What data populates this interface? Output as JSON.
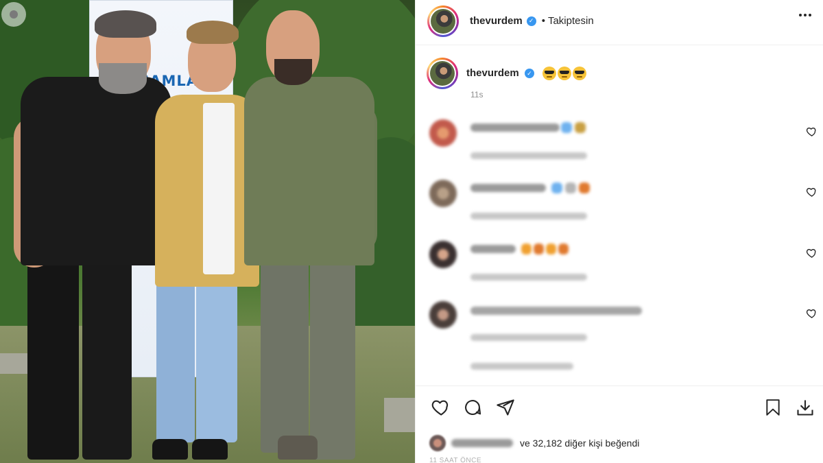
{
  "post": {
    "username": "thevurdem",
    "verified_mark": "✓",
    "follow_status": "Takiptesin",
    "separator": "•",
    "caption_emojis": [
      "sunglasses-emoji",
      "sunglasses-emoji",
      "sunglasses-emoji"
    ],
    "posted": "11s"
  },
  "photo": {
    "banner_text": "ĞAMLAR M"
  },
  "comments": [
    {
      "avatar_color": "#c25a4c",
      "name_color": "#9b9b9b",
      "badge_colors": [
        "#6fb2ef",
        "#c9a043"
      ]
    },
    {
      "avatar_color": "#7e6a5a",
      "name_color": "#9b9b9b",
      "badge_colors": [
        "#6fb2ef",
        "#e07a2f"
      ]
    },
    {
      "avatar_color": "#3a3030",
      "name_color": "#9b9b9b",
      "badge_colors": [
        "#f0a030",
        "#e07a2f",
        "#f0a030",
        "#e07a2f"
      ]
    },
    {
      "avatar_color": "#4a3e3a",
      "name_color": "#9b9b9b",
      "badge_colors": []
    }
  ],
  "likes": {
    "text": "ve 32,182 diğer kişi beğendi"
  },
  "time_ago": "11 SAAT ÖNCE",
  "colors": {
    "verified_blue": "#3897f0",
    "text_primary": "#262626",
    "text_muted": "#8e8e8e"
  },
  "icons": [
    "heart-icon",
    "comment-icon",
    "share-icon",
    "bookmark-icon",
    "download-icon",
    "more-icon"
  ]
}
